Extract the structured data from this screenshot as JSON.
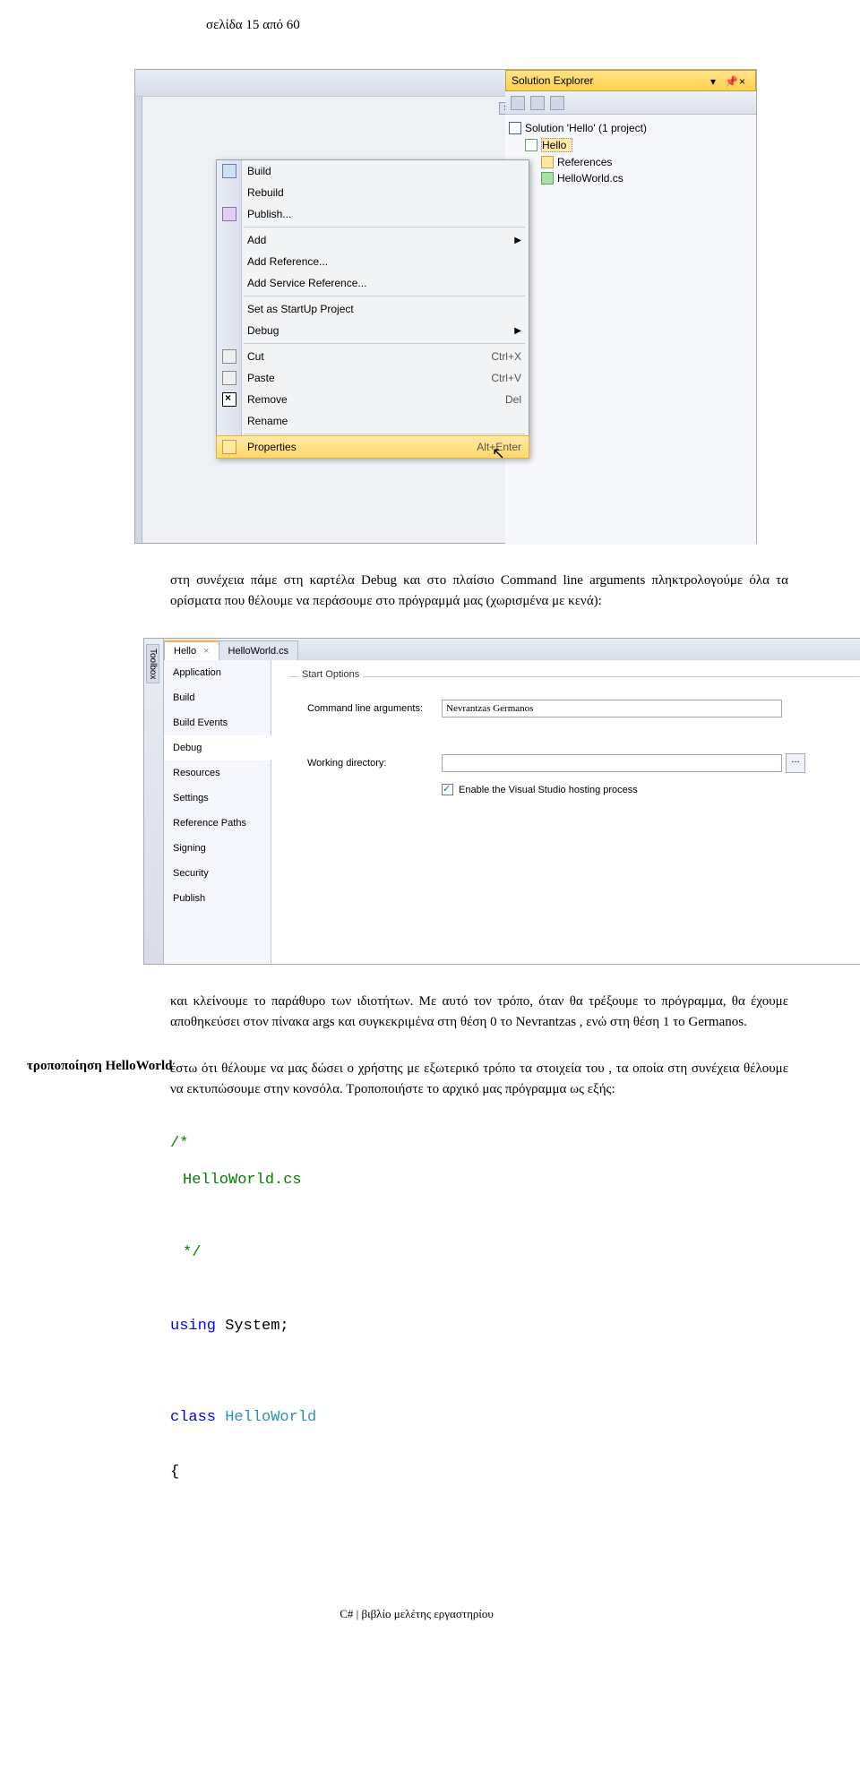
{
  "page_header": "σελίδα 15 από 60",
  "screenshot1": {
    "solution_explorer": {
      "title": "Solution Explorer",
      "tree": {
        "solution": "Solution 'Hello' (1 project)",
        "project": "Hello",
        "references": "References",
        "file": "HelloWorld.cs"
      }
    },
    "context_menu": {
      "build": "Build",
      "rebuild": "Rebuild",
      "publish": "Publish...",
      "add": "Add",
      "add_reference": "Add Reference...",
      "add_service_ref": "Add Service Reference...",
      "set_startup": "Set as StartUp Project",
      "debug": "Debug",
      "cut": "Cut",
      "cut_sc": "Ctrl+X",
      "paste": "Paste",
      "paste_sc": "Ctrl+V",
      "remove": "Remove",
      "remove_sc": "Del",
      "rename": "Rename",
      "properties": "Properties",
      "properties_sc": "Alt+Enter"
    },
    "grip": "↕"
  },
  "paragraph1": "στη συνέχεια πάμε στη καρτέλα Debug και στο πλαίσιο Command line arguments πληκτρολογούμε όλα τα ορίσματα που θέλουμε να περάσουμε στο πρόγραμμά μας (χωρισμένα με κενά):",
  "screenshot2": {
    "toolbox": "Toolbox",
    "tabs": {
      "tab1": "Hello",
      "tab2": "HelloWorld.cs"
    },
    "nav": {
      "application": "Application",
      "build": "Build",
      "build_events": "Build Events",
      "debug": "Debug",
      "resources": "Resources",
      "settings": "Settings",
      "reference_paths": "Reference Paths",
      "signing": "Signing",
      "security": "Security",
      "publish": "Publish"
    },
    "content": {
      "groupbox": "Start Options",
      "cmdline_label": "Command line arguments:",
      "cmdline_value": "Nevrantzas Germanos",
      "workdir_label": "Working directory:",
      "workdir_value": "",
      "browse": "...",
      "hosting_cb": "Enable the Visual Studio hosting process"
    }
  },
  "paragraph2": "και κλείνουμε το παράθυρο των ιδιοτήτων. Με αυτό τον τρόπο, όταν θα τρέξουμε το πρόγραμμα, θα έχουμε αποθηκεύσει στον πίνακα args και συγκεκριμένα στη θέση 0 το Nevrantzas , ενώ στη θέση 1 το Germanos.",
  "section_label": "τροποποίηση HelloWorld",
  "paragraph3": "έστω ότι θέλουμε να μας δώσει ο χρήστης με εξωτερικό τρόπο τα στοιχεία του , τα οποία στη συνέχεια θέλουμε να εκτυπώσουμε στην κονσόλα. Τροποποιήστε το αρχικό μας πρόγραμμα ως εξής:",
  "code": {
    "l1": "/*",
    "l2": "HelloWorld.cs",
    "l3": "*/",
    "l4_kw": "using",
    "l4_rest": " System;",
    "l5_kw": "class",
    "l5_type": " HelloWorld",
    "l6": "{"
  },
  "footer": "C# | βιβλίο μελέτης εργαστηρίου"
}
